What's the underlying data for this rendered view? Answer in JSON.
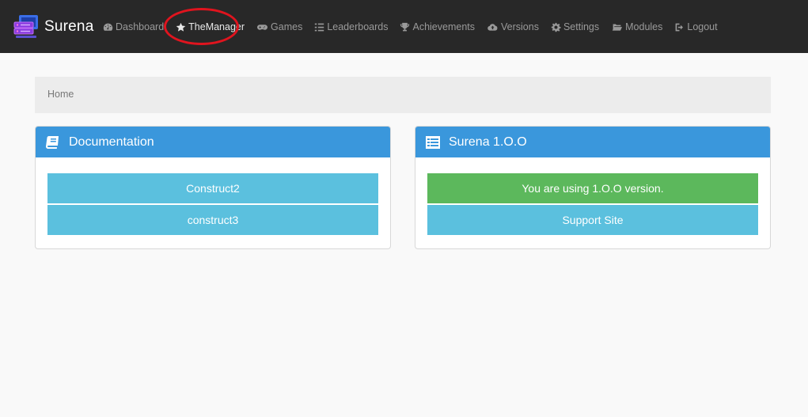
{
  "brand": {
    "name": "Surena"
  },
  "nav": {
    "items": [
      {
        "label": "Dashboard",
        "icon": "dashboard-icon"
      },
      {
        "label": "TheManager",
        "icon": "star-icon"
      },
      {
        "label": "Games",
        "icon": "gamepad-icon"
      },
      {
        "label": "Leaderboards",
        "icon": "list-icon"
      },
      {
        "label": "Achievements",
        "icon": "trophy-icon"
      },
      {
        "label": "Versions",
        "icon": "cloud-icon"
      },
      {
        "label": "Settings",
        "icon": "gear-icon"
      },
      {
        "label": "Modules",
        "icon": "folder-icon"
      },
      {
        "label": "Logout",
        "icon": "logout-icon"
      }
    ]
  },
  "breadcrumb": {
    "home": "Home"
  },
  "docs_panel": {
    "title": "Documentation",
    "buttons": [
      "Construct2",
      "construct3"
    ]
  },
  "version_panel": {
    "title": "Surena 1.O.O",
    "status": "You are using 1.O.O version.",
    "support": "Support Site"
  },
  "colors": {
    "navbar": "#282828",
    "panel_heading": "#3a97dc",
    "info": "#5bc0de",
    "success": "#5cb85c",
    "highlight": "#e0141e"
  }
}
